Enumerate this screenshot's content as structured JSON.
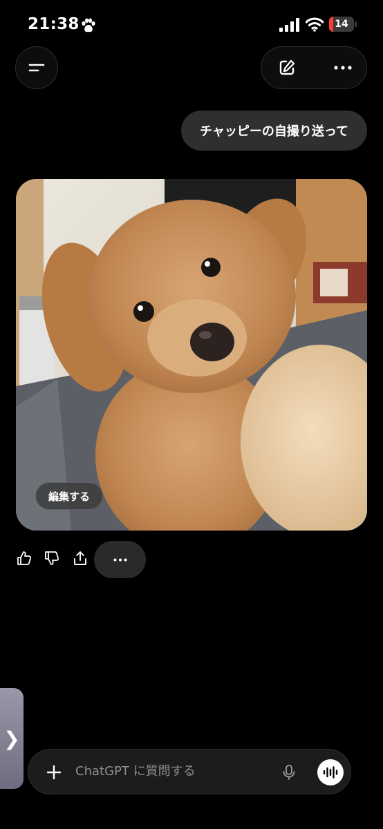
{
  "status_bar": {
    "time": "21:38",
    "battery_level": "14",
    "icons": [
      "paw-icon",
      "signal-icon",
      "wifi-icon",
      "battery-icon"
    ]
  },
  "top_bar": {
    "icons": [
      "menu-icon",
      "new-chat-icon",
      "more-icon"
    ]
  },
  "messages": [
    {
      "role": "user",
      "text": "チャッピーの自撮り送って"
    },
    {
      "role": "assistant",
      "type": "image",
      "edit_label": "編集する"
    }
  ],
  "actions": {
    "icons": [
      "thumbs-up-icon",
      "thumbs-down-icon",
      "share-icon",
      "more-icon"
    ]
  },
  "composer": {
    "placeholder": "ChatGPT に質問する",
    "icons": [
      "plus-icon",
      "mic-icon",
      "voice-mode-icon"
    ]
  },
  "side_handle": {
    "label": "❯"
  },
  "colors": {
    "background": "#000000",
    "bubble": "#2f2f2f",
    "composer": "#1c1c1c",
    "battery_low": "#ff3b30"
  }
}
